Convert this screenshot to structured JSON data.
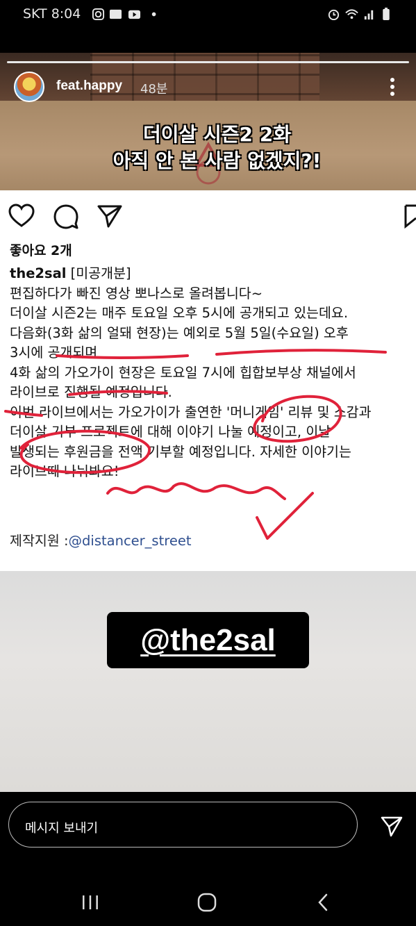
{
  "status_bar": {
    "carrier_time": "SKT 8:04",
    "icons": [
      "instagram-icon",
      "webtoon-icon",
      "youtube-icon",
      "dot-icon",
      "alarm-icon",
      "wifi-icon",
      "signal-icon",
      "battery-icon"
    ]
  },
  "story": {
    "username": "feat.happy",
    "time_ago": "48분",
    "caption_lines": [
      "더이살 시즌2 2화",
      "아직 안 본 사람 없겠지?!"
    ]
  },
  "post": {
    "likes": "좋아요 2개",
    "author": "the2sal",
    "lines": [
      "[미공개분]",
      "편집하다가 빠진 영상 뽀나스로 올려봅니다~",
      "더이살 시즌2는 매주 토요일 오후 5시에 공개되고 있는데요.",
      "다음화(3화 삶의 얼돼 현장)는 예외로 5월 5일(수요일) 오후",
      "3시에 공개되며",
      "4화 삶의 가오가이 현장은 토요일 7시에 힙합보부상 채널에서",
      "라이브로 진행될 예정입니다.",
      "이번 라이브에서는 가오가이가 출연한 '머니게임' 리뷰 및 소감과",
      "더이살 기부 프로젝트에 대해 이야기 나눌 예정이고, 이날",
      "발생되는 후원금을 전액 기부할 예정입니다. 자세한 이야기는",
      "라이브때 나눠봐요!"
    ],
    "credit_label": "제작지원 :",
    "credit_handle": "@distancer_street"
  },
  "mention": {
    "text": "@the2sal"
  },
  "bottom_bar": {
    "message_placeholder": "메시지 보내기"
  },
  "colors": {
    "annotation_red": "#e0223a",
    "link_blue": "#2f4f8f"
  }
}
